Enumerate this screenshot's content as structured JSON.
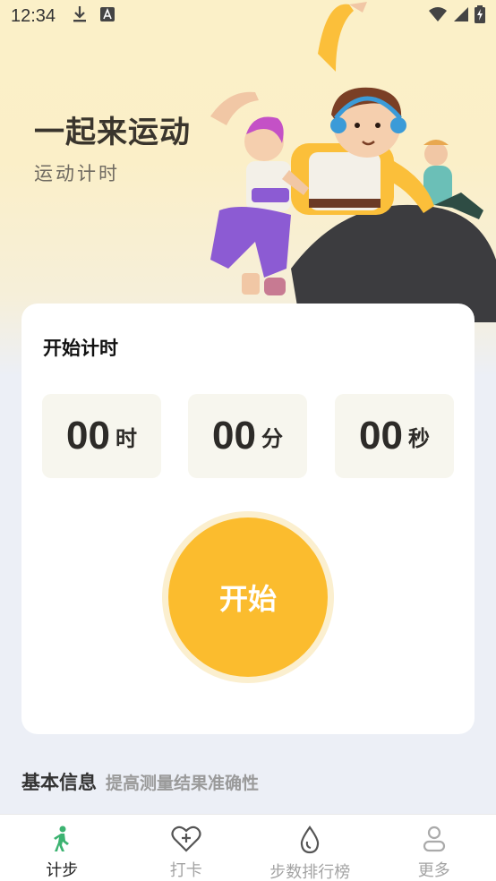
{
  "status_bar": {
    "time": "12:34",
    "left_icons": [
      "download-icon",
      "font-a-icon"
    ],
    "right_icons": [
      "wifi-icon",
      "signal-icon",
      "battery-charging-icon"
    ]
  },
  "hero": {
    "title": "一起来运动",
    "subtitle": "运动计时"
  },
  "timer": {
    "title": "开始计时",
    "hours": "00",
    "hours_unit": "时",
    "minutes": "00",
    "minutes_unit": "分",
    "seconds": "00",
    "seconds_unit": "秒",
    "start_label": "开始"
  },
  "basic_info": {
    "title": "基本信息",
    "subtitle": "提高测量结果准确性"
  },
  "bottom_nav": {
    "items": [
      {
        "label": "计步",
        "icon": "walking-icon",
        "active": true
      },
      {
        "label": "打卡",
        "icon": "heart-plus-icon",
        "active": false
      },
      {
        "label": "步数排行榜",
        "icon": "water-drop-icon",
        "active": false
      },
      {
        "label": "更多",
        "icon": "person-icon",
        "active": false
      }
    ]
  },
  "colors": {
    "accent": "#fbbc2e",
    "active_nav": "#3cb371",
    "background_top": "#fbf0c8",
    "background_bottom": "#eceff6"
  }
}
